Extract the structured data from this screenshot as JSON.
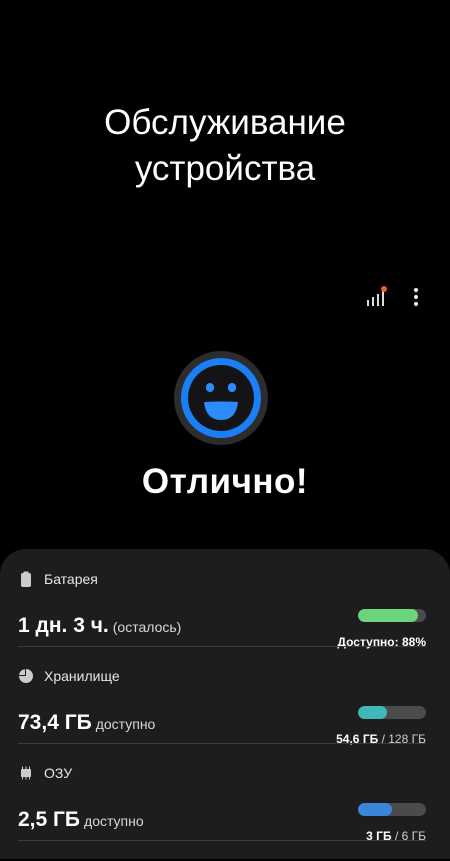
{
  "header": {
    "title_line1": "Обслуживание",
    "title_line2": "устройства"
  },
  "toolbar": {
    "stats_icon": "bar-chart-icon",
    "more_icon": "more-vertical-icon",
    "badge_color": "#e8602c"
  },
  "status": {
    "face_icon": "smiley-face-icon",
    "ring_color": "#1a7ef5",
    "label": "Отлично!"
  },
  "battery": {
    "label": "Батарея",
    "value": "1 дн. 3 ч.",
    "note": "(осталось)",
    "right_text": "Доступно: 88%",
    "fill_fraction": 0.88,
    "color": "#6dd47e"
  },
  "storage": {
    "label": "Хранилище",
    "value": "73,4 ГБ",
    "note": "доступно",
    "used": "54,6 ГБ",
    "total": "/ 128 ГБ",
    "fill_fraction": 0.43,
    "color": "#3fb8b8"
  },
  "ram": {
    "label": "ОЗУ",
    "value": "2,5 ГБ",
    "note": "доступно",
    "used": "3 ГБ",
    "total": "/ 6 ГБ",
    "fill_fraction": 0.5,
    "color": "#3a86d8"
  }
}
